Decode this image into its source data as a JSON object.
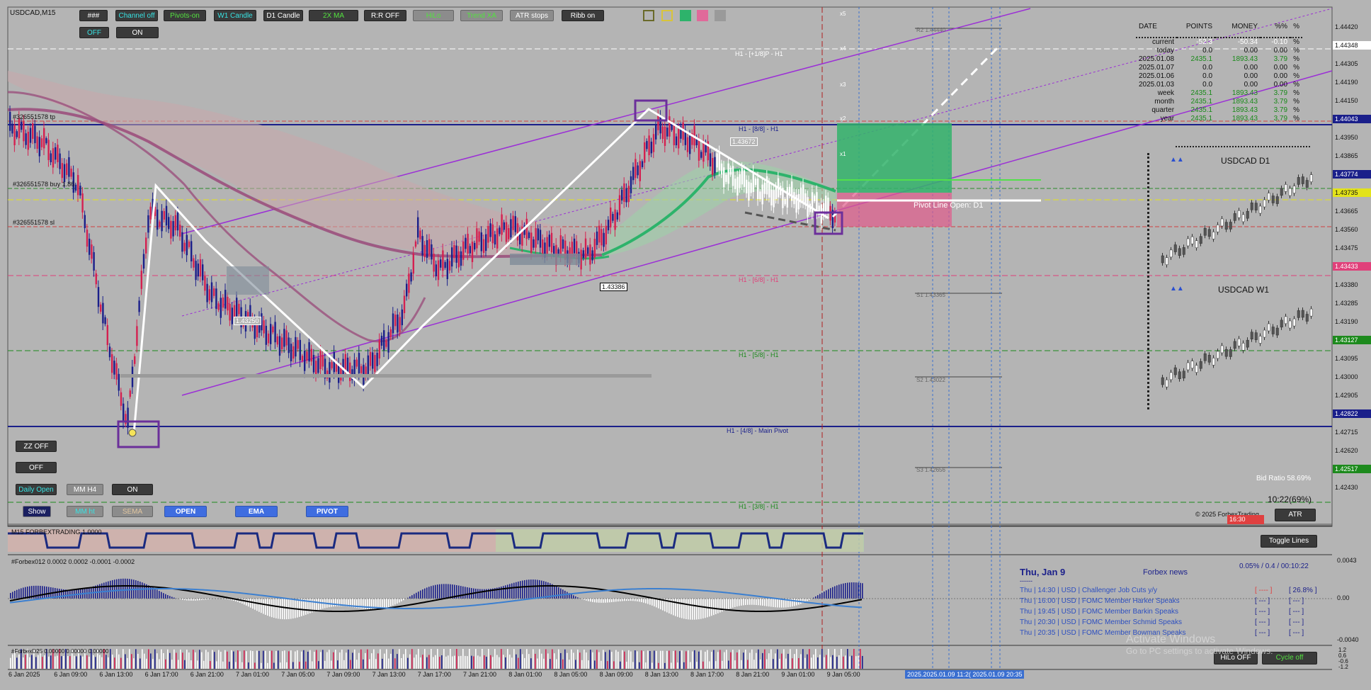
{
  "symbol_label": "USDCAD,M15",
  "toolbar_row1": [
    "###",
    "Channel off",
    "Pivots-on",
    "W1 Candle",
    "D1 Candle",
    "2X MA",
    "R:R OFF",
    "HiLo",
    "Trend XA",
    "ATR stops",
    "Ribb on"
  ],
  "toolbar_row2": [
    "OFF",
    "ON"
  ],
  "left_panel": {
    "zz": "ZZ OFF",
    "off": "OFF",
    "daily_open": "Daily Open",
    "mm_h4": "MM H4",
    "on": "ON",
    "show": "Show",
    "mm_ht": "MM ht",
    "sema": "SEMA",
    "open": "OPEN",
    "ema": "EMA",
    "pivot": "PIVOT"
  },
  "chart_labels": {
    "tp": "#326551578 tp",
    "buy": "#326551578 buy 1.86",
    "sl": "#326551578 sl",
    "p_1_8": "H1 - [+1/8]P - H1",
    "p_8_8": "H1 - [8/8] - H1",
    "p_6_8": "H1 - [6/8] - H1",
    "p_5_8": "H1 - [5/8] - H1",
    "p_4_8": "H1 - [4/8] - Main Pivot",
    "p_3_8": "H1 - [3/8] - H1",
    "r2": "R2 1.44440",
    "s1": "S1 1.43365",
    "s2": "S2 1.43022",
    "s3": "S3 1.42656",
    "pivot_line": "Pivot Line  Open: D1",
    "low_label": "1.43386",
    "low2_label": "1.43250",
    "hi_label": "1.43672",
    "x5": "x5",
    "x4": "x4",
    "x3": "x3",
    "x2": "x2",
    "x1": "x1",
    "bid_ratio": "Bid Ratio 58.69%",
    "timer": "10:22(69%)",
    "copyright": "© 2025 ForbexTrading",
    "clock": "16:30",
    "atr": "ATR",
    "toggle_lines": "Toggle Lines"
  },
  "price_axis": [
    {
      "v": "1.44420",
      "hl": ""
    },
    {
      "v": "1.44348",
      "hl": "white"
    },
    {
      "v": "1.44305",
      "hl": ""
    },
    {
      "v": "1.44190",
      "hl": ""
    },
    {
      "v": "1.44150",
      "hl": ""
    },
    {
      "v": "1.44043",
      "hl": "navy"
    },
    {
      "v": "1.43950",
      "hl": ""
    },
    {
      "v": "1.43865",
      "hl": ""
    },
    {
      "v": "1.43774",
      "hl": "navy"
    },
    {
      "v": "1.43735",
      "hl": "yellow"
    },
    {
      "v": "1.43665",
      "hl": ""
    },
    {
      "v": "1.43560",
      "hl": ""
    },
    {
      "v": "1.43475",
      "hl": ""
    },
    {
      "v": "1.43433",
      "hl": "pink"
    },
    {
      "v": "1.43380",
      "hl": ""
    },
    {
      "v": "1.43285",
      "hl": ""
    },
    {
      "v": "1.43190",
      "hl": ""
    },
    {
      "v": "1.43127",
      "hl": "green"
    },
    {
      "v": "1.43095",
      "hl": ""
    },
    {
      "v": "1.43000",
      "hl": ""
    },
    {
      "v": "1.42905",
      "hl": ""
    },
    {
      "v": "1.42822",
      "hl": "navy"
    },
    {
      "v": "1.42715",
      "hl": ""
    },
    {
      "v": "1.42620",
      "hl": ""
    },
    {
      "v": "1.42517",
      "hl": "green"
    },
    {
      "v": "1.42430",
      "hl": ""
    }
  ],
  "stats_table": {
    "headers": [
      "DATE",
      "POINTS",
      "MONEY",
      "%%",
      "%"
    ],
    "rows": [
      [
        "current",
        "-52.3",
        "-50.34",
        "-0.10",
        "%"
      ],
      [
        "today",
        "0.0",
        "0.00",
        "0.00",
        "%"
      ],
      [
        "2025.01.08",
        "2435.1",
        "1893.43",
        "3.79",
        "%"
      ],
      [
        "2025.01.07",
        "0.0",
        "0.00",
        "0.00",
        "%"
      ],
      [
        "2025.01.06",
        "0.0",
        "0.00",
        "0.00",
        "%"
      ],
      [
        "2025.01.03",
        "0.0",
        "0.00",
        "0.00",
        "%"
      ],
      [
        "week",
        "2435.1",
        "1893.43",
        "3.79",
        "%"
      ],
      [
        "month",
        "2435.1",
        "1893.43",
        "3.79",
        "%"
      ],
      [
        "quarter",
        "2435.1",
        "1893.43",
        "3.79",
        "%"
      ],
      [
        "year",
        "2435.1",
        "1893.43",
        "3.79",
        "%"
      ]
    ]
  },
  "mini_charts": {
    "d1": "USDCAD  D1",
    "w1": "USDCAD  W1"
  },
  "subwindow1": {
    "title": "M15 FORBEXTRADING 1.0000"
  },
  "subwindow2": {
    "title": "#Forbex012 0.0002 0.0002 -0.0001 -0.0002",
    "axis": [
      "0.0043",
      "0.00",
      "-0.0040"
    ]
  },
  "subwindow3": {
    "title": "#ForbexD25 0.00000 0.00000 0.00000",
    "axis": [
      "1.2",
      "0.6",
      "-0.6",
      "-1.2"
    ]
  },
  "news": {
    "date": "Thu, Jan 9",
    "source": "Forbex news",
    "divider": "------",
    "stats": "0.05% / 0.4 / 00:10:22",
    "items": [
      {
        "text": "Thu  |  14:30  |  USD  |  Challenger Job Cuts y/y",
        "a": "[ ---- ]",
        "b": "[ 26.8% ]"
      },
      {
        "text": "Thu  |  16:00  |  USD  |  FOMC Member Harker Speaks",
        "a": "[ --- ]",
        "b": "[ --- ]"
      },
      {
        "text": "Thu  |  19:45  |  USD  |  FOMC Member Barkin Speaks",
        "a": "[ --- ]",
        "b": "[ --- ]"
      },
      {
        "text": "Thu  |  20:30  |  USD  |  FOMC Member Schmid Speaks",
        "a": "[ --- ]",
        "b": "[ --- ]"
      },
      {
        "text": "Thu  |  20:35  |  USD  |  FOMC Member Bowman Speaks",
        "a": "[ --- ]",
        "b": "[ --- ]"
      }
    ]
  },
  "bottom_buttons": {
    "hilo": "HiLo OFF",
    "cycle": "Cycle off"
  },
  "watermark": {
    "line1": "Activate Windows",
    "line2": "Go to PC settings to activate Windows."
  },
  "time_axis": [
    "6 Jan 2025",
    "6 Jan 09:00",
    "6 Jan 13:00",
    "6 Jan 17:00",
    "6 Jan 21:00",
    "7 Jan 01:00",
    "7 Jan 05:00",
    "7 Jan 09:00",
    "7 Jan 13:00",
    "7 Jan 17:00",
    "7 Jan 21:00",
    "8 Jan 01:00",
    "8 Jan 05:00",
    "8 Jan 09:00",
    "8 Jan 13:00",
    "8 Jan 17:00",
    "8 Jan 21:00",
    "9 Jan 01:00",
    "9 Jan 05:00"
  ],
  "time_range": "2025.2025.01.09 11:2( 2025.01.09 20:35",
  "colors": {
    "bg": "#b4b4b4",
    "purple": "#9b2fd6",
    "navy": "#1a1f8a",
    "pink": "#e0407a",
    "green": "#2db36b"
  }
}
